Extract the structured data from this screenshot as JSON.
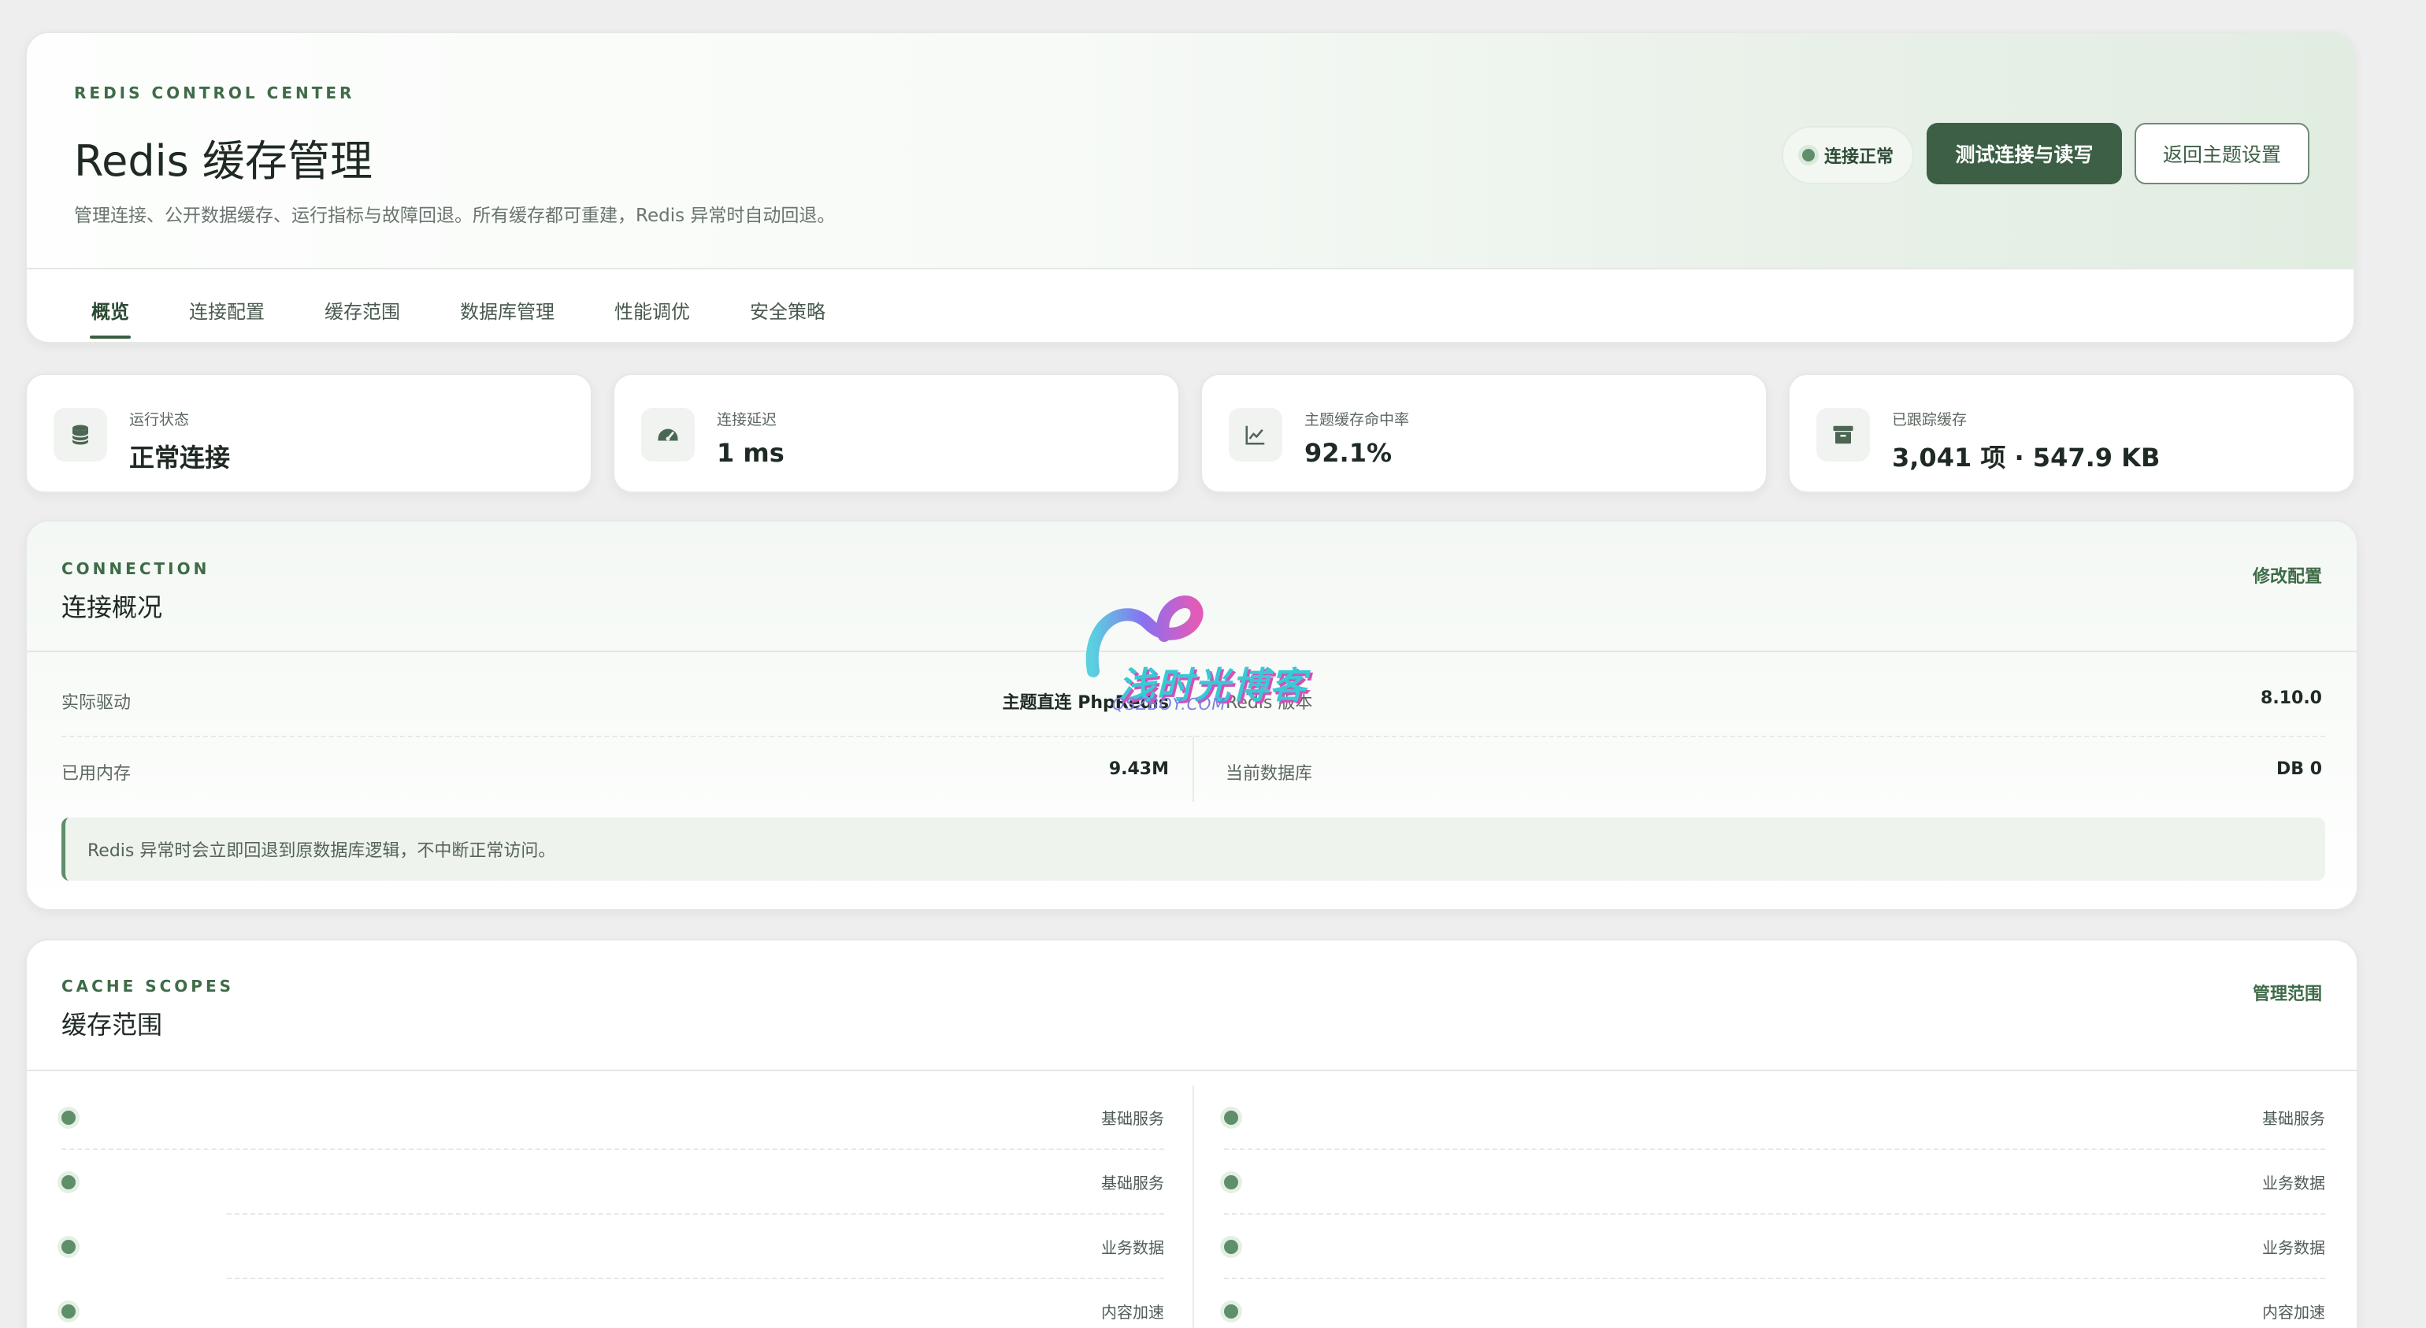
{
  "header": {
    "eyebrow": "REDIS CONTROL CENTER",
    "title": "Redis 缓存管理",
    "subtitle": "管理连接、公开数据缓存、运行指标与故障回退。所有缓存都可重建，Redis 异常时自动回退。",
    "status_label": "连接正常",
    "test_button": "测试连接与读写",
    "back_button": "返回主题设置",
    "tabs": [
      "概览",
      "连接配置",
      "缓存范围",
      "数据库管理",
      "性能调优",
      "安全策略"
    ],
    "active_tab": "概览"
  },
  "stats": [
    {
      "label": "运行状态",
      "value": "正常连接",
      "icon": "database-icon"
    },
    {
      "label": "连接延迟",
      "value": "1 ms",
      "icon": "speedometer-icon"
    },
    {
      "label": "主题缓存命中率",
      "value": "92.1%",
      "icon": "chart-icon"
    },
    {
      "label": "已跟踪缓存",
      "value": "3,041 项 · 547.9 KB",
      "icon": "archive-icon"
    }
  ],
  "connection": {
    "eyebrow": "CONNECTION",
    "title": "连接概况",
    "edit_link": "修改配置",
    "rows": [
      {
        "label": "实际驱动",
        "value": "主题直连 PhpRedis"
      },
      {
        "label": "Redis 版本",
        "value": "8.10.0"
      },
      {
        "label": "已用内存",
        "value": "9.43M"
      },
      {
        "label": "当前数据库",
        "value": "DB 0"
      }
    ],
    "note": "Redis 异常时会立即回退到原数据库逻辑，不中断正常访问。"
  },
  "scopes": {
    "eyebrow": "CACHE SCOPES",
    "title": "缓存范围",
    "manage_link": "管理范围",
    "left": [
      "基础服务",
      "基础服务",
      "业务数据",
      "内容加速"
    ],
    "right": [
      "基础服务",
      "业务数据",
      "业务数据",
      "内容加速"
    ]
  },
  "watermark": {
    "text": "浅时光博客",
    "sub": "QSZBOY.COM"
  },
  "colors": {
    "accent": "#3c5f45",
    "status_dot": "#5e8f68"
  }
}
